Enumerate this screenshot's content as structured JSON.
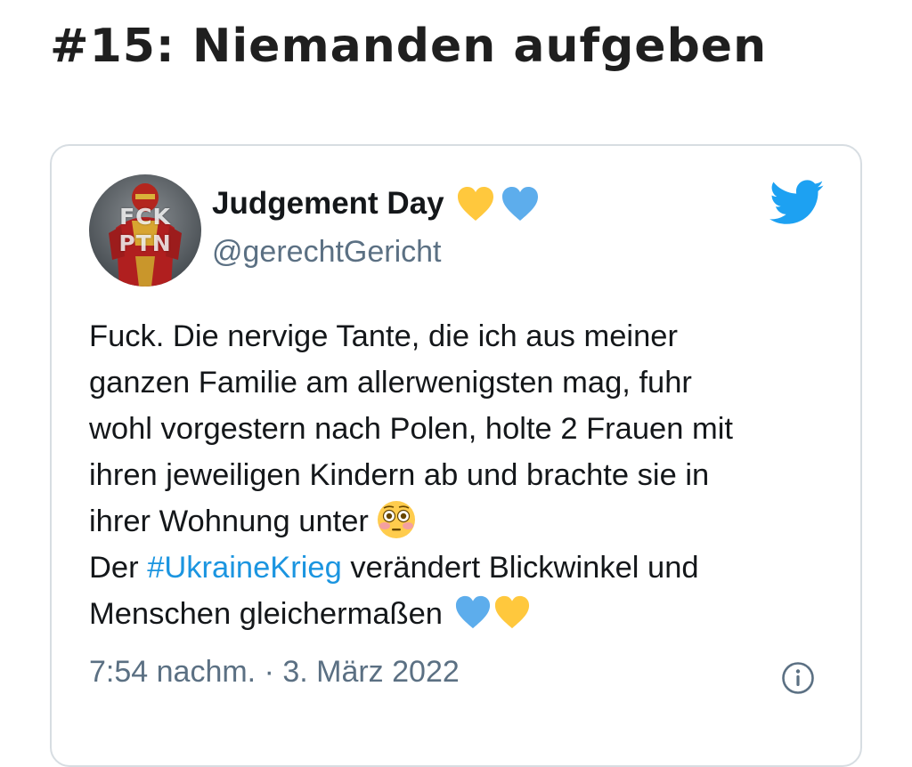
{
  "page": {
    "title": "#15: Niemanden aufgeben"
  },
  "tweet": {
    "author": {
      "display_name": "Judgement Day",
      "handle": "@gerechtGericht",
      "avatar_text": [
        "FCK",
        "PTN"
      ],
      "name_emojis": [
        "yellow-heart",
        "blue-heart"
      ]
    },
    "body": {
      "line1": "Fuck. Die nervige Tante, die ich aus meiner",
      "line2": "ganzen Familie am allerwenigsten mag, fuhr",
      "line3": "wohl vorgestern nach Polen, holte 2 Frauen mit",
      "line4": "ihren jeweiligen Kindern ab und brachte sie in",
      "line5": "ihrer Wohnung unter",
      "line6_prefix": "Der ",
      "hashtag": "#UkraineKrieg",
      "line6_suffix": " verändert Blickwinkel und",
      "line7": "Menschen gleichermaßen",
      "emojis": [
        "flushed-face",
        "blue-heart",
        "yellow-heart"
      ]
    },
    "timestamp": "7:54 nachm. · 3. März 2022"
  },
  "icons": {
    "twitter": "twitter-bird-icon",
    "info": "info-icon"
  },
  "colors": {
    "twitter_blue": "#1da1f2",
    "hashtag_blue": "#1b95e0",
    "secondary_text": "#5b7083",
    "card_border": "#d7dde2",
    "heart_yellow": "#ffc83d",
    "heart_blue": "#5dadec"
  }
}
